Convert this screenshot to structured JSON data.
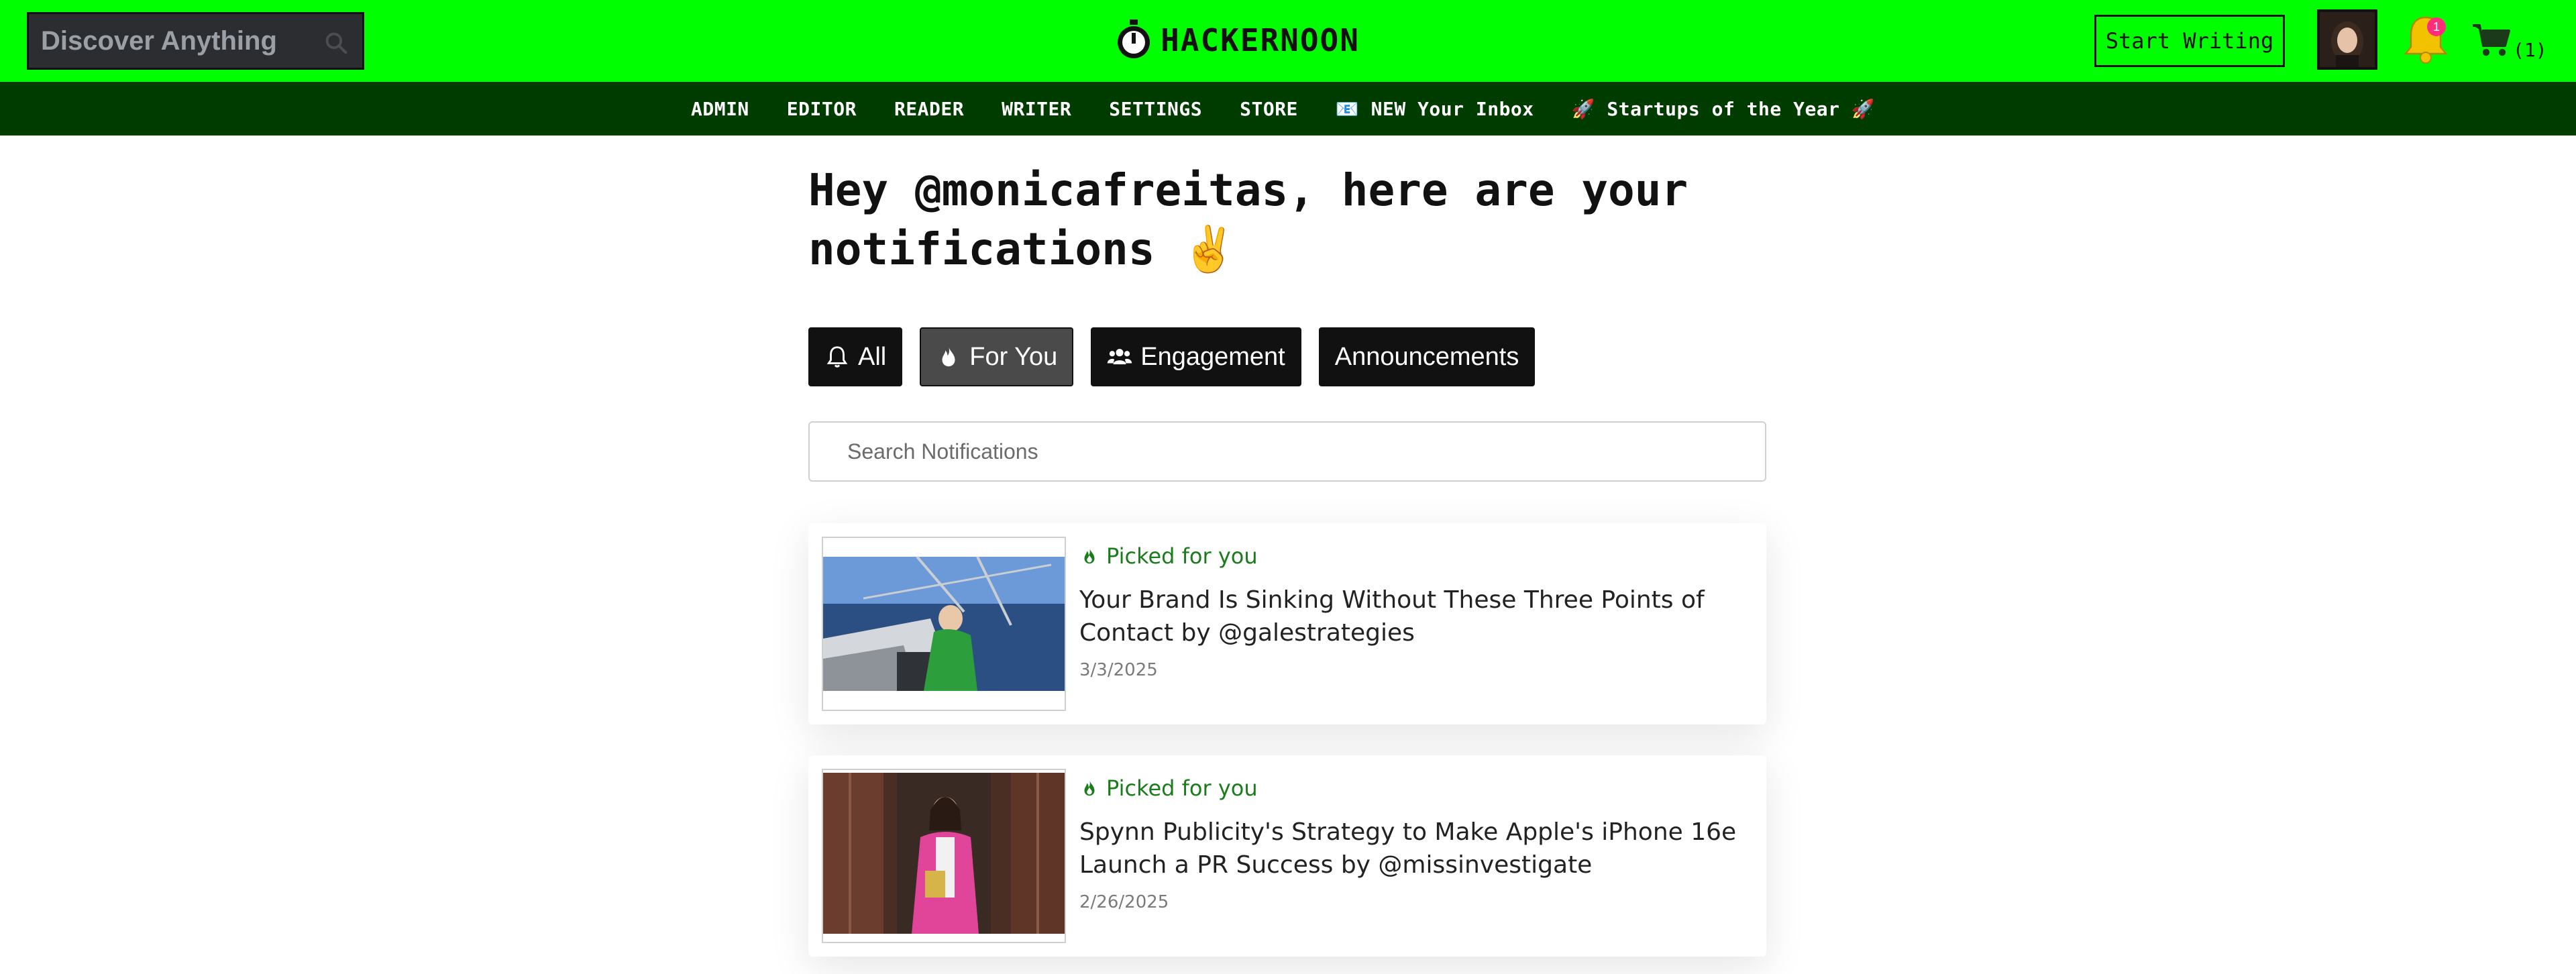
{
  "header": {
    "search_placeholder": "Discover Anything",
    "logo_text": "HACKERNOON",
    "start_writing_label": "Start Writing",
    "notification_count": "1",
    "cart_count": "(1)",
    "brand_color": "#00ff00"
  },
  "nav": {
    "items": [
      {
        "label": "ADMIN"
      },
      {
        "label": "EDITOR"
      },
      {
        "label": "READER"
      },
      {
        "label": "WRITER"
      },
      {
        "label": "SETTINGS"
      },
      {
        "label": "STORE"
      },
      {
        "label": "📧 NEW Your Inbox"
      },
      {
        "label": "🚀 Startups of the Year 🚀"
      }
    ]
  },
  "main": {
    "title": "Hey @monicafreitas, here are your notifications ✌️",
    "filters": [
      {
        "label": "All",
        "icon": "bell-icon"
      },
      {
        "label": "For You",
        "icon": "flame-icon",
        "active": true
      },
      {
        "label": "Engagement",
        "icon": "users-icon"
      },
      {
        "label": "Announcements",
        "icon": ""
      }
    ],
    "search_placeholder": "Search Notifications",
    "notifications": [
      {
        "tag": "Picked for you",
        "title": "Your Brand Is Sinking Without These Three Points of Contact by @galestrategies",
        "date": "3/3/2025"
      },
      {
        "tag": "Picked for you",
        "title": "Spynn Publicity's Strategy to Make Apple's iPhone 16e Launch a PR Success by @missinvestigate",
        "date": "2/26/2025"
      }
    ]
  }
}
